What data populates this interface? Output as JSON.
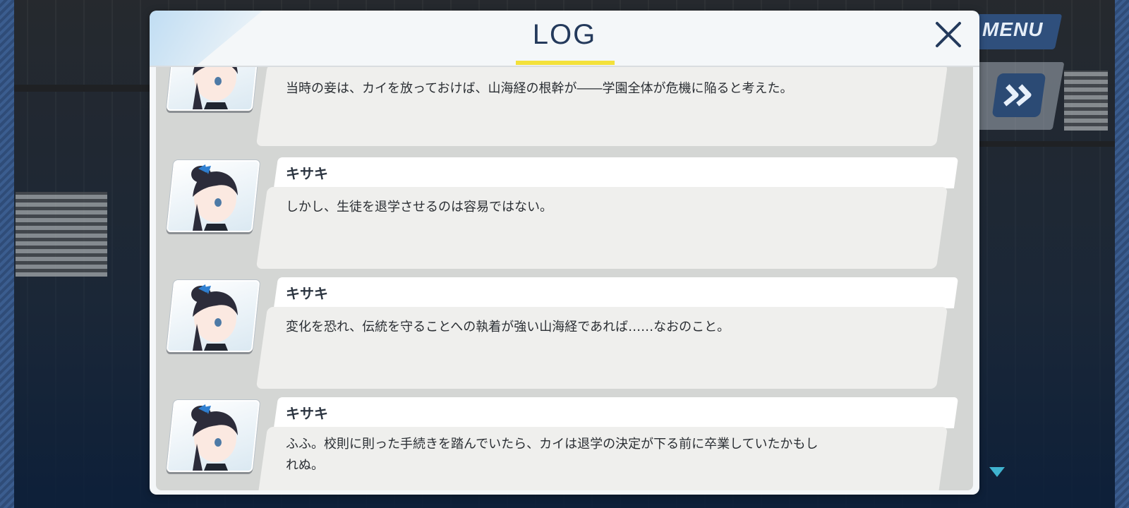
{
  "dialog": {
    "title": "LOG"
  },
  "hud": {
    "menu_label": "MENU"
  },
  "log_entries": [
    {
      "speaker": "",
      "text": "当時の妾は、カイを放っておけば、山海経の根幹が――学園全体が危機に陥ると考えた。"
    },
    {
      "speaker": "キサキ",
      "text": "しかし、生徒を退学させるのは容易ではない。"
    },
    {
      "speaker": "キサキ",
      "text": "変化を恐れ、伝統を守ることへの執着が強い山海経であれば……なおのこと。"
    },
    {
      "speaker": "キサキ",
      "text": "ふふ。校則に則った手続きを踏んでいたら、カイは退学の決定が下る前に卒業していたかもし\nれぬ。"
    }
  ],
  "colors": {
    "title": "#243a5c",
    "underline": "#f3e13b",
    "hud_blue": "#2f4f7c"
  }
}
